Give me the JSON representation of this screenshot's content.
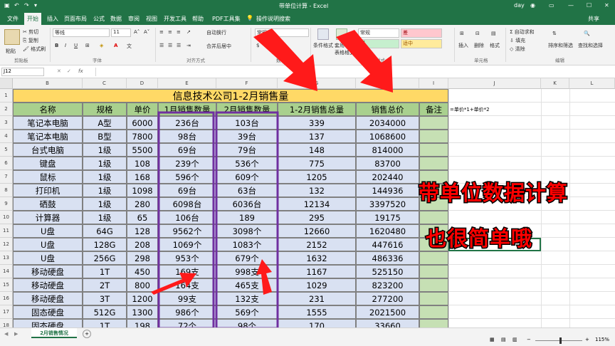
{
  "window": {
    "title": "带单位计算 - Excel",
    "user": "day"
  },
  "ribbon_tabs": [
    "文件",
    "开始",
    "插入",
    "页面布局",
    "公式",
    "数据",
    "审阅",
    "视图",
    "开发工具",
    "帮助",
    "PDF工具集"
  ],
  "tell_me": "操作说明搜索",
  "share": "共享",
  "ribbon": {
    "clipboard": {
      "cut": "剪切",
      "copy": "复制",
      "paint": "格式刷",
      "paste": "粘贴",
      "group": "剪贴板"
    },
    "font": {
      "name": "等线",
      "size": "11",
      "group": "字体",
      "bold": "B",
      "italic": "I",
      "underline": "U"
    },
    "align": {
      "wrap": "自动换行",
      "merge": "合并后居中",
      "group": "对齐方式"
    },
    "number": {
      "format": "常规",
      "group": "数字"
    },
    "styles": {
      "cond": "条件格式",
      "table": "套用\n表格格式",
      "normal": "常规",
      "bad": "差",
      "good": "好",
      "neutral": "适中",
      "group": "样式"
    },
    "cells": {
      "insert": "插入",
      "delete": "删除",
      "format": "格式",
      "group": "单元格"
    },
    "editing": {
      "autosum": "自动求和",
      "fill": "填充",
      "clear": "清除",
      "sort": "排序和筛选",
      "find": "查找和选择",
      "group": "编辑"
    }
  },
  "formula_bar": {
    "name_box": "J12",
    "fx": "fx",
    "content": ""
  },
  "columns": [
    "B",
    "C",
    "D",
    "E",
    "F",
    "G",
    "H",
    "I",
    "J",
    "K",
    "L"
  ],
  "rows": [
    "1",
    "2",
    "3",
    "4",
    "5",
    "6",
    "7",
    "8",
    "9",
    "10",
    "11",
    "12",
    "13",
    "14",
    "15",
    "16",
    "17",
    "18"
  ],
  "sheet": {
    "title": "信息技术公司1-2月销售量",
    "headers": [
      "名称",
      "规格",
      "单价",
      "1月销售数量",
      "2月销售数量",
      "1-2月销售总量",
      "销售总价",
      "备注"
    ],
    "formula_note": "=单价*1+单价*2",
    "data": [
      [
        "笔记本电脑",
        "A型",
        "6000",
        "236台",
        "103台",
        "339",
        "2034000"
      ],
      [
        "笔记本电脑",
        "B型",
        "7800",
        "98台",
        "39台",
        "137",
        "1068600"
      ],
      [
        "台式电脑",
        "1级",
        "5500",
        "69台",
        "79台",
        "148",
        "814000"
      ],
      [
        "键盘",
        "1级",
        "108",
        "239个",
        "536个",
        "775",
        "83700"
      ],
      [
        "鼠标",
        "1级",
        "168",
        "596个",
        "609个",
        "1205",
        "202440"
      ],
      [
        "打印机",
        "1级",
        "1098",
        "69台",
        "63台",
        "132",
        "144936"
      ],
      [
        "硒鼓",
        "1级",
        "280",
        "6098台",
        "6036台",
        "12134",
        "3397520"
      ],
      [
        "计算器",
        "1级",
        "65",
        "106台",
        "189",
        "295",
        "19175"
      ],
      [
        "U盘",
        "64G",
        "128",
        "9562个",
        "3098个",
        "12660",
        "1620480"
      ],
      [
        "U盘",
        "128G",
        "208",
        "1069个",
        "1083个",
        "2152",
        "447616"
      ],
      [
        "U盘",
        "256G",
        "298",
        "953个",
        "679个",
        "1632",
        "486336"
      ],
      [
        "移动硬盘",
        "1T",
        "450",
        "169支",
        "998支",
        "1167",
        "525150"
      ],
      [
        "移动硬盘",
        "2T",
        "800",
        "164支",
        "465支",
        "1029",
        "823200"
      ],
      [
        "移动硬盘",
        "3T",
        "1200",
        "99支",
        "132支",
        "231",
        "277200"
      ],
      [
        "固态硬盘",
        "512G",
        "1300",
        "986个",
        "569个",
        "1555",
        "2021500"
      ],
      [
        "固态硬盘",
        "1T",
        "198",
        "72个",
        "98个",
        "170",
        "33660"
      ]
    ]
  },
  "overlay": {
    "line1": "带单位数据计算",
    "line2": "也很简单哦"
  },
  "status": {
    "sheet_tab": "2月销售情况",
    "add": "+",
    "zoom": "115%"
  },
  "colors": {
    "excel_green": "#217346",
    "title_fill": "#ffd966",
    "header_fill": "#a9d08e",
    "data_fill": "#d9e1f2",
    "note_fill": "#c6e0b4",
    "arrow": "#ff1a1a",
    "box": "#7030a0",
    "overlay_text": "#ff0000"
  }
}
